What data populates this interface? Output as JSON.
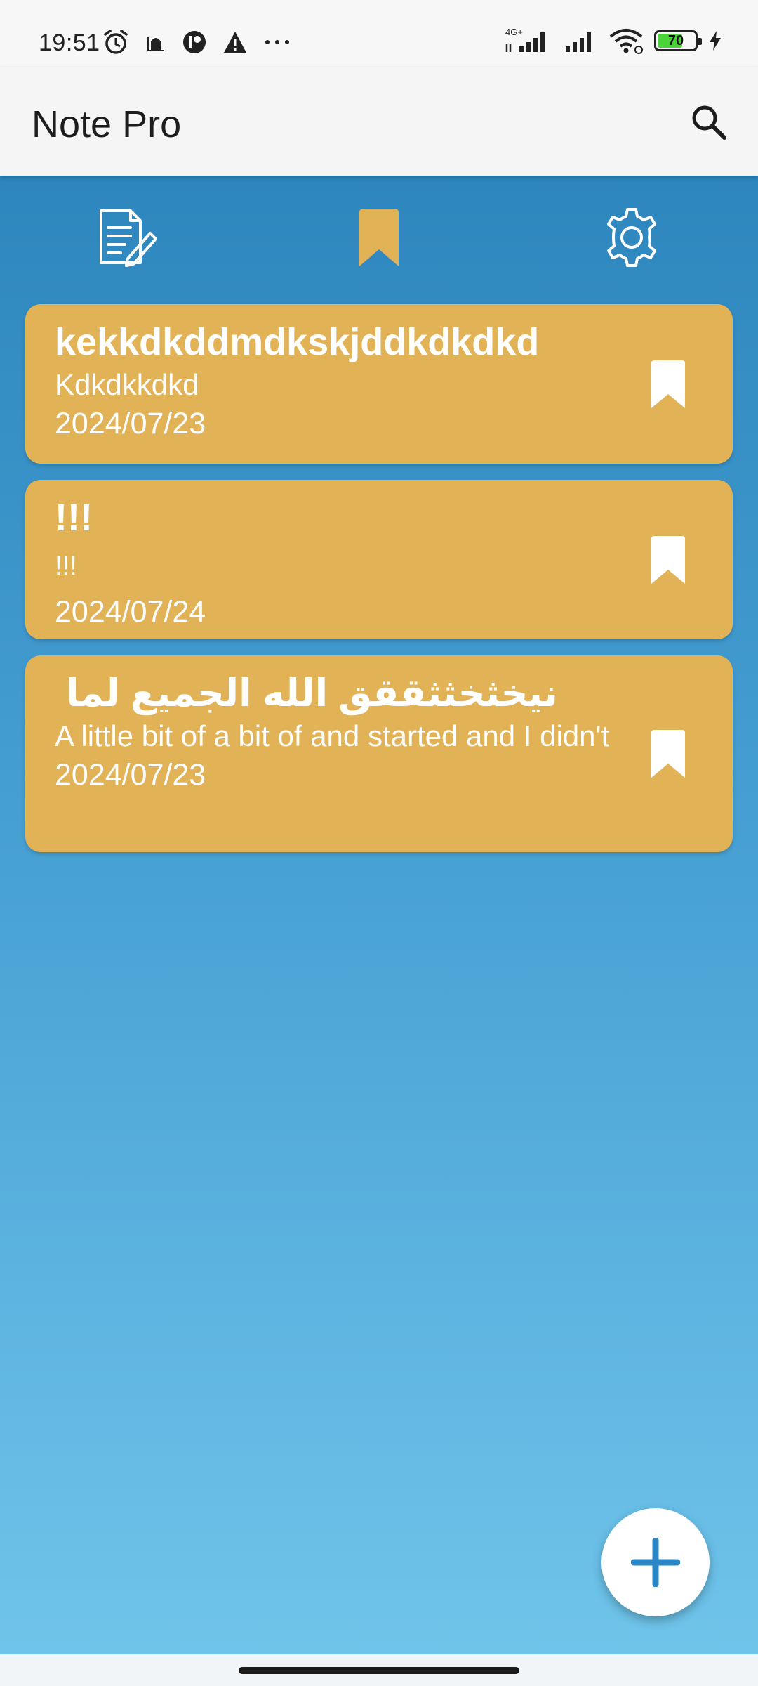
{
  "status_bar": {
    "time": "19:51",
    "network_label": "4G+",
    "battery_percent": "70",
    "battery_level": 0.7,
    "icons_left": [
      "alarm-icon",
      "mosque-icon",
      "app-icon",
      "warning-icon",
      "more-dots-icon"
    ],
    "icons_right": [
      "signal-4g-icon",
      "signal-icon",
      "wifi-icon",
      "battery-icon",
      "charging-icon"
    ]
  },
  "app_bar": {
    "title": "Note Pro",
    "search_icon": "search-icon"
  },
  "tabs": [
    {
      "name": "notes",
      "icon": "note-edit-icon",
      "active": false
    },
    {
      "name": "bookmarks",
      "icon": "bookmark-icon",
      "active": true
    },
    {
      "name": "settings",
      "icon": "gear-icon",
      "active": false
    }
  ],
  "notes": [
    {
      "title": "kekkdkddmdkskjddkdkdkd",
      "body": "Kdkdkkdkd",
      "date": "2024/07/23",
      "bookmarked": true
    },
    {
      "title": "!!!",
      "body": "!!!",
      "date": "2024/07/24",
      "bookmarked": true
    },
    {
      "title": "نيخثخثثققق الله الجميع لما",
      "body": "A little bit of a bit of and started and I didn't",
      "date": "2024/07/23",
      "bookmarked": true
    }
  ],
  "fab": {
    "icon": "plus-icon"
  },
  "colors": {
    "card": "#e2b257",
    "accent_blue": "#2d86bd",
    "active_tab": "#e2b257",
    "app_bar": "#f5f5f5"
  }
}
